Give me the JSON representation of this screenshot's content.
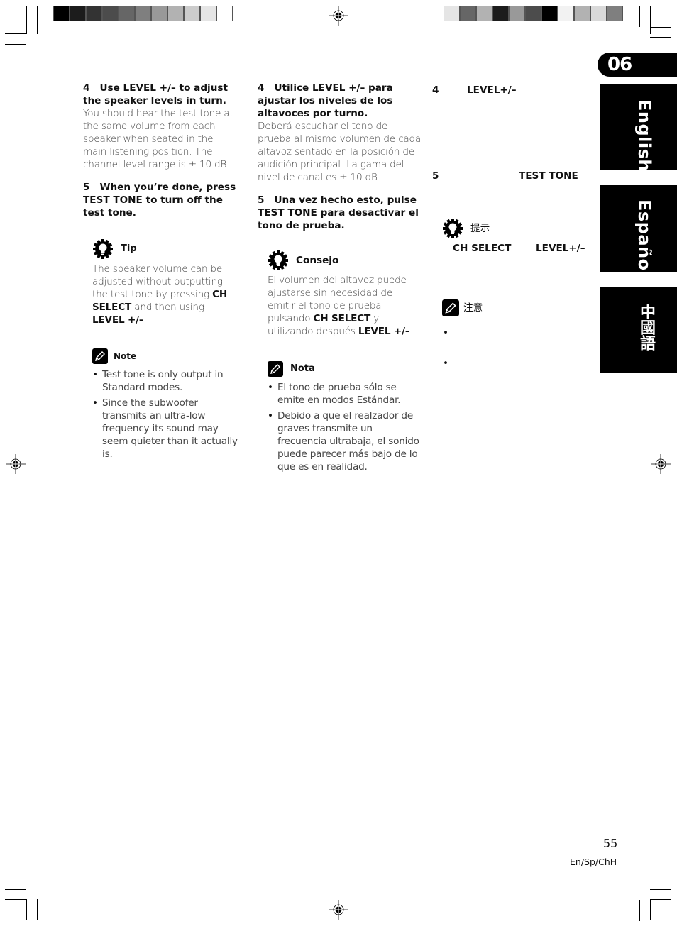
{
  "colorbar_left": [
    "#000000",
    "#1c1c1c",
    "#333333",
    "#4c4c4c",
    "#666666",
    "#7f7f7f",
    "#999999",
    "#b2b2b2",
    "#cccccc",
    "#e5e5e5",
    "#ffffff"
  ],
  "colorbar_right": [
    "#e5e5e5",
    "#666666",
    "#b2b2b2",
    "#1c1c1c",
    "#999999",
    "#4c4c4c",
    "#000000",
    "#f2f2f2",
    "#b2b2b2",
    "#d9d9d9",
    "#7f7f7f"
  ],
  "english": {
    "step4": {
      "num": "4",
      "title": "Use LEVEL +/– to adjust the speaker levels in turn.",
      "body": "You should hear the test tone at the same volume from each speaker when seated in the main listening position. The channel level range is ± 10 dB."
    },
    "step5": {
      "num": "5",
      "title": "When you’re done, press TEST TONE to turn off the test tone."
    },
    "tip": {
      "label": "Tip",
      "pre": "The speaker volume can be adjusted without outputting the test tone by pressing ",
      "b1": "CH SELECT",
      "mid": " and then using ",
      "b2": "LEVEL +/–",
      "post": "."
    },
    "note": {
      "label": "Note",
      "items": [
        "Test tone is only output in Standard modes.",
        "Since the subwoofer transmits an ultra-low frequency its sound may seem quieter than it actually is."
      ]
    }
  },
  "spanish": {
    "step4": {
      "num": "4",
      "title": "Utilice LEVEL +/– para ajustar los niveles de los altavoces  por turno.",
      "body": "Deberá escuchar el tono de prueba al mismo volumen de cada altavoz sentado en la posición de audición principal. La gama del nivel de canal es ± 10 dB."
    },
    "step5": {
      "num": "5",
      "title": "Una vez hecho esto, pulse TEST TONE para desactivar el tono de prueba."
    },
    "tip": {
      "label": "Consejo",
      "pre": "El volumen del altavoz puede ajustarse sin necesidad de emitir el tono de prueba pulsando ",
      "b1": "CH SELECT",
      "mid": " y utilizando después ",
      "b2": "LEVEL +/–",
      "post": "."
    },
    "note": {
      "label": "Nota",
      "items": [
        "El tono de prueba sólo se emite en modos Estándar.",
        "Debido a que el realzador de graves transmite un frecuencia ultrabaja, el sonido puede parecer más bajo de lo que es en realidad."
      ]
    }
  },
  "chinese": {
    "step4": {
      "num": "4",
      "title": "LEVEL+/–"
    },
    "step5": {
      "num": "5",
      "title": "TEST TONE"
    },
    "tip": {
      "label": "提示",
      "b1": "CH SELECT",
      "b2": "LEVEL+/–"
    },
    "note": {
      "label": "注意",
      "items": [
        "",
        ""
      ]
    }
  },
  "sidebar": {
    "chapter": "06",
    "tabs": [
      "English",
      "Español",
      "中國語"
    ]
  },
  "footer": {
    "page_number": "55",
    "code": "En/Sp/ChH"
  }
}
